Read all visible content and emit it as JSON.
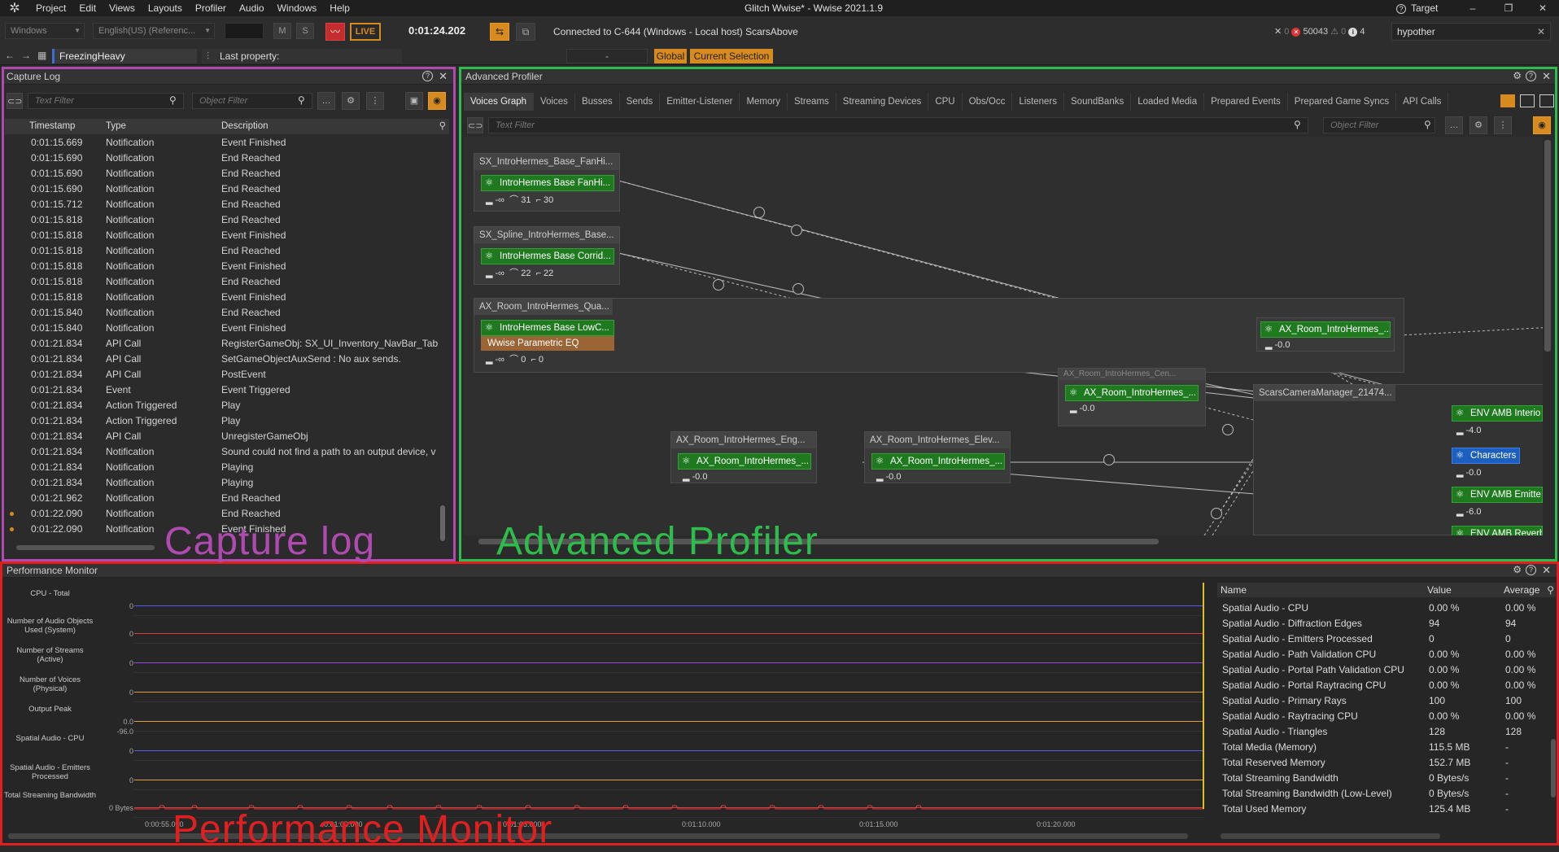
{
  "menubar": {
    "items": [
      "Project",
      "Edit",
      "Views",
      "Layouts",
      "Profiler",
      "Audio",
      "Windows",
      "Help"
    ],
    "title": "Glitch Wwise* - Wwise 2021.1.9",
    "target_label": "Target"
  },
  "toolbar": {
    "platform": "Windows",
    "language": "English(US) (Referenc...",
    "mute_label": "M",
    "solo_label": "S",
    "live_label": "LIVE",
    "time": "0:01:24.202",
    "connection": "Connected to C-644 (Windows - Local host) ScarsAbove",
    "error_count": "0",
    "code": "50043",
    "warning_count": "0",
    "info_count": "4",
    "search_value": "hypother"
  },
  "toolbar2": {
    "object_name": "FreezingHeavy",
    "last_property": "Last property:",
    "dash": "-",
    "global_label": "Global",
    "current_selection_label": "Current Selection"
  },
  "capture_log": {
    "title": "Capture Log",
    "text_filter_placeholder": "Text Filter",
    "object_filter_placeholder": "Object Filter",
    "columns": [
      "Timestamp",
      "Type",
      "Description"
    ],
    "rows": [
      {
        "ts": "0:01:15.669",
        "type": "Notification",
        "desc": "Event Finished"
      },
      {
        "ts": "0:01:15.690",
        "type": "Notification",
        "desc": "End Reached"
      },
      {
        "ts": "0:01:15.690",
        "type": "Notification",
        "desc": "End Reached"
      },
      {
        "ts": "0:01:15.690",
        "type": "Notification",
        "desc": "End Reached"
      },
      {
        "ts": "0:01:15.712",
        "type": "Notification",
        "desc": "End Reached"
      },
      {
        "ts": "0:01:15.818",
        "type": "Notification",
        "desc": "End Reached"
      },
      {
        "ts": "0:01:15.818",
        "type": "Notification",
        "desc": "Event Finished"
      },
      {
        "ts": "0:01:15.818",
        "type": "Notification",
        "desc": "End Reached"
      },
      {
        "ts": "0:01:15.818",
        "type": "Notification",
        "desc": "Event Finished"
      },
      {
        "ts": "0:01:15.818",
        "type": "Notification",
        "desc": "End Reached"
      },
      {
        "ts": "0:01:15.818",
        "type": "Notification",
        "desc": "Event Finished"
      },
      {
        "ts": "0:01:15.840",
        "type": "Notification",
        "desc": "End Reached"
      },
      {
        "ts": "0:01:15.840",
        "type": "Notification",
        "desc": "Event Finished"
      },
      {
        "ts": "0:01:21.834",
        "type": "API Call",
        "desc": "RegisterGameObj: SX_UI_Inventory_NavBar_Tab_Ho"
      },
      {
        "ts": "0:01:21.834",
        "type": "API Call",
        "desc": "SetGameObjectAuxSend : No aux sends."
      },
      {
        "ts": "0:01:21.834",
        "type": "API Call",
        "desc": "PostEvent"
      },
      {
        "ts": "0:01:21.834",
        "type": "Event",
        "desc": "Event Triggered"
      },
      {
        "ts": "0:01:21.834",
        "type": "Action Triggered",
        "desc": "Play"
      },
      {
        "ts": "0:01:21.834",
        "type": "Action Triggered",
        "desc": "Play"
      },
      {
        "ts": "0:01:21.834",
        "type": "API Call",
        "desc": "UnregisterGameObj"
      },
      {
        "ts": "0:01:21.834",
        "type": "Notification",
        "desc": "Sound could not find a path to an output device, v"
      },
      {
        "ts": "0:01:21.834",
        "type": "Notification",
        "desc": "Playing"
      },
      {
        "ts": "0:01:21.834",
        "type": "Notification",
        "desc": "Playing"
      },
      {
        "ts": "0:01:21.962",
        "type": "Notification",
        "desc": "End Reached"
      },
      {
        "ts": "0:01:22.090",
        "type": "Notification",
        "desc": "End Reached"
      },
      {
        "ts": "0:01:22.090",
        "type": "Notification",
        "desc": "Event Finished"
      }
    ],
    "overlay_label": "Capture log"
  },
  "advanced_profiler": {
    "title": "Advanced Profiler",
    "tabs": [
      "Voices Graph",
      "Voices",
      "Busses",
      "Sends",
      "Emitter-Listener",
      "Memory",
      "Streams",
      "Streaming Devices",
      "CPU",
      "Obs/Occ",
      "Listeners",
      "SoundBanks",
      "Loaded Media",
      "Prepared Events",
      "Prepared Game Syncs",
      "API Calls"
    ],
    "text_filter_placeholder": "Text Filter",
    "object_filter_placeholder": "Object Filter",
    "graph": {
      "groups": [
        {
          "title": "SX_IntroHermes_Base_FanHi...",
          "node": "IntroHermes Base FanHi...",
          "stats": [
            "-∞",
            "31",
            "30"
          ]
        },
        {
          "title": "SX_Spline_IntroHermes_Base...",
          "node": "IntroHermes Base Corrid...",
          "stats": [
            "-∞",
            "22",
            "22"
          ]
        },
        {
          "title": "AX_Room_IntroHermes_Qua...",
          "node": "IntroHermes Base LowC...",
          "sub": "Wwise Parametric EQ",
          "stats": [
            "-∞",
            "0",
            "0"
          ]
        },
        {
          "title": "AX_Room_IntroHermes_Eng...",
          "node": "AX_Room_IntroHermes_...",
          "stats": [
            "-0.0"
          ]
        },
        {
          "title": "AX_Room_IntroHermes_Elev...",
          "node": "AX_Room_IntroHermes_...",
          "stats": [
            "-0.0"
          ]
        },
        {
          "title": "AX_Room_IntroHermes_Cen...",
          "node": "AX_Room_IntroHermes_...",
          "stats": [
            "-0.0"
          ]
        },
        {
          "title": "",
          "node": "AX_Room_IntroHermes_...",
          "stats": [
            "-0.0"
          ]
        },
        {
          "title": "ScarsCameraManager_21474...",
          "node": "",
          "stats": []
        }
      ],
      "right_nodes": [
        {
          "label": "ENV AMB Interio",
          "value": "-4.0"
        },
        {
          "label": "Characters",
          "value": "-0.0"
        },
        {
          "label": "ENV AMB Emitte",
          "value": "-6.0"
        },
        {
          "label": "ENV AMB Reverb",
          "value": ""
        }
      ]
    },
    "overlay_label": "Advanced Profiler"
  },
  "performance_monitor": {
    "title": "Performance Monitor",
    "graphs": [
      {
        "label": "CPU - Total",
        "zero": "0"
      },
      {
        "label": "Number of Audio Objects Used (System)",
        "zero": "0"
      },
      {
        "label": "Number of Streams (Active)",
        "zero": "0"
      },
      {
        "label": "Number of Voices (Physical)",
        "zero": "0"
      },
      {
        "label": "Output Peak",
        "zero": "0.0",
        "low": "-96.0"
      },
      {
        "label": "Spatial Audio - CPU",
        "zero": "0"
      },
      {
        "label": "Spatial Audio - Emitters Processed",
        "zero": "0"
      },
      {
        "label": "Total Streaming Bandwidth",
        "zero": "0 Bytes"
      }
    ],
    "time_ticks": [
      "0:00:55.000",
      "0:01:00.000",
      "0:01:05.000",
      "0:01:10.000",
      "0:01:15.000",
      "0:01:20.000"
    ],
    "columns": [
      "Name",
      "Value",
      "Average"
    ],
    "rows": [
      {
        "name": "Spatial Audio - CPU",
        "value": "0.00 %",
        "avg": "0.00 %"
      },
      {
        "name": "Spatial Audio - Diffraction Edges",
        "value": "94",
        "avg": "94"
      },
      {
        "name": "Spatial Audio - Emitters Processed",
        "value": "0",
        "avg": "0"
      },
      {
        "name": "Spatial Audio - Path Validation CPU",
        "value": "0.00 %",
        "avg": "0.00 %"
      },
      {
        "name": "Spatial Audio - Portal Path Validation CPU",
        "value": "0.00 %",
        "avg": "0.00 %"
      },
      {
        "name": "Spatial Audio - Portal Raytracing CPU",
        "value": "0.00 %",
        "avg": "0.00 %"
      },
      {
        "name": "Spatial Audio - Primary Rays",
        "value": "100",
        "avg": "100"
      },
      {
        "name": "Spatial Audio - Raytracing CPU",
        "value": "0.00 %",
        "avg": "0.00 %"
      },
      {
        "name": "Spatial Audio - Triangles",
        "value": "128",
        "avg": "128"
      },
      {
        "name": "Total Media (Memory)",
        "value": "115.5 MB",
        "avg": "-"
      },
      {
        "name": "Total Reserved Memory",
        "value": "152.7 MB",
        "avg": "-"
      },
      {
        "name": "Total Streaming Bandwidth",
        "value": "0 Bytes/s",
        "avg": "-"
      },
      {
        "name": "Total Streaming Bandwidth (Low-Level)",
        "value": "0 Bytes/s",
        "avg": "-"
      },
      {
        "name": "Total Used Memory",
        "value": "125.4 MB",
        "avg": "-"
      }
    ],
    "overlay_label": "Performance Monitor"
  },
  "colors": {
    "capture_overlay": "#b04ab0",
    "profiler_overlay": "#2ebd4c",
    "perf_overlay": "#e02020",
    "accent_orange": "#d68a1f",
    "node_green": "#1f7a1f",
    "node_blue": "#1d5fbf"
  },
  "icons": [
    "wwise-logo-icon",
    "back-icon",
    "forward-icon",
    "grid-icon",
    "link-icon",
    "search-icon",
    "eye-icon",
    "save-icon",
    "settings-icon",
    "help-icon",
    "close-icon",
    "info-icon",
    "warning-icon",
    "error-icon"
  ]
}
